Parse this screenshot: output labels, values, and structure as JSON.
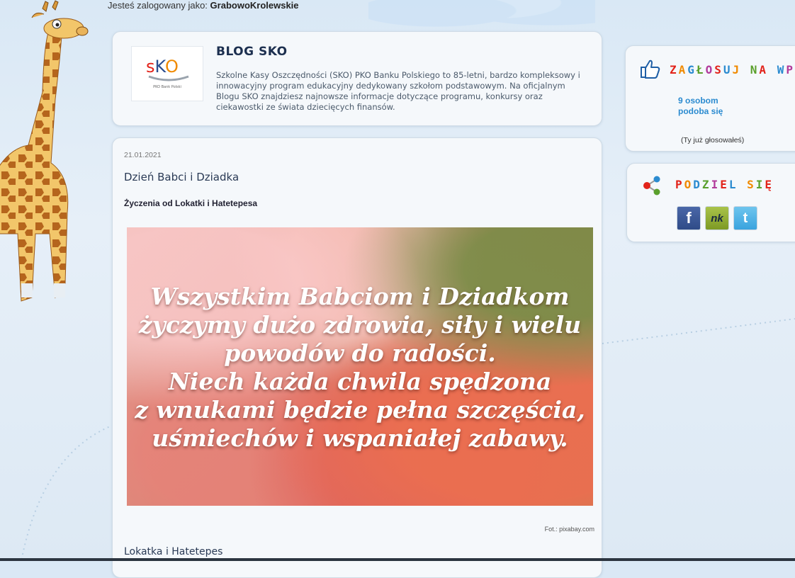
{
  "login": {
    "prefix": "Jesteś zalogowany jako:",
    "username": "GrabowoKrolewskie"
  },
  "header": {
    "logo_text": "SKO",
    "logo_sub": "PKO Bank Polski",
    "title": "BLOG SKO",
    "description": "Szkolne Kasy Oszczędności (SKO) PKO Banku Polskiego to 85-letni, bardzo kompleksowy i innowacyjny program edukacyjny dedykowany szkołom podstawowym. Na oficjalnym Blogu SKO znajdziesz najnowsze informacje dotyczące programu, konkursy oraz ciekawostki ze świata dziecięcych finansów."
  },
  "post": {
    "date": "21.01.2021",
    "title": "Dzień Babci i Dziadka",
    "subtitle": "Życzenia od Lokatki i Hatetepesa",
    "image_lines": [
      "Wszystkim Babciom i Dziadkom",
      "życzymy dużo zdrowia, siły i wielu",
      "powodów do radości.",
      "Niech każda chwila spędzona",
      "z wnukami będzie pełna szczęścia,",
      "uśmiechów i wspaniałej zabawy."
    ],
    "photo_credit": "Fot.: pixabay.com",
    "author": "Lokatka i Hatetepes"
  },
  "vote": {
    "title": "ZAGŁOSUJ NA WPIS",
    "count_line1": "9 osobom",
    "count_line2": "podoba się",
    "note": "(Ty już głosowałeś)"
  },
  "share": {
    "title": "PODZIEL SIĘ",
    "facebook": "f",
    "nk": "nk",
    "twitter": "t"
  },
  "colors": {
    "title_letters": [
      "#e2231a",
      "#f08a00",
      "#2b8bd0",
      "#5aa02c",
      "#b23a9b",
      "#e2231a",
      "#2b8bd0",
      "#f08a00",
      "#5aa02c",
      "#e2231a",
      "#2b8bd0",
      "#b23a9b",
      "#f08a00",
      "#5aa02c",
      "#e2231a",
      "#2b8bd0"
    ],
    "accent_blue": "#2b8bd0"
  }
}
